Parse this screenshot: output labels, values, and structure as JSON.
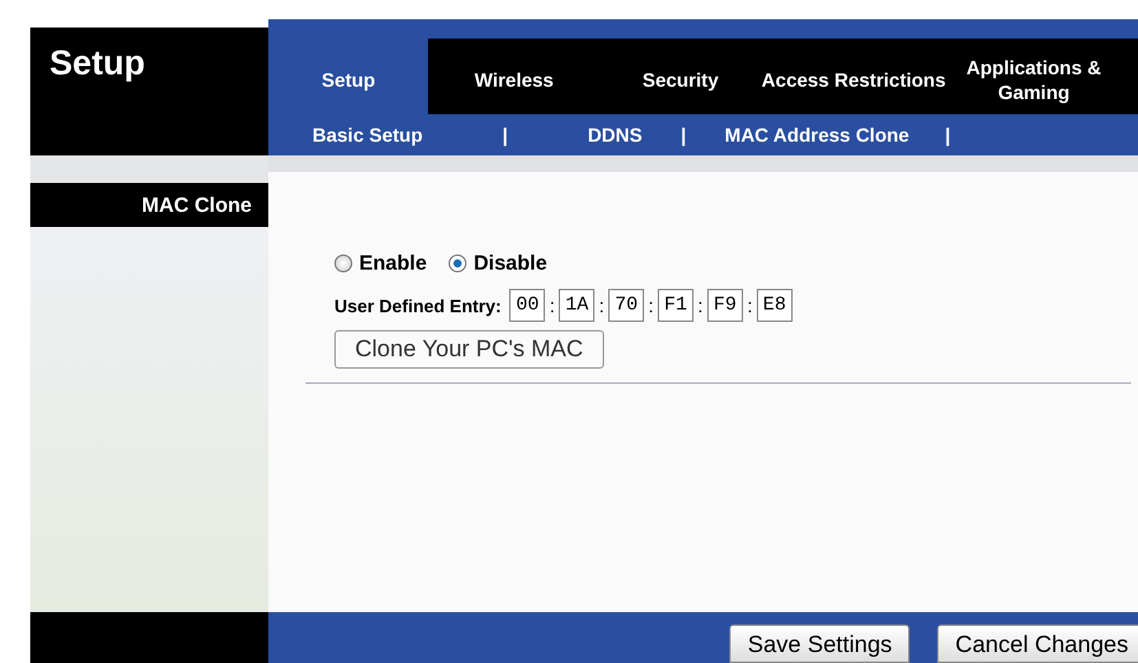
{
  "page_title": "Setup",
  "tabs": [
    {
      "label": "Setup",
      "selected": true
    },
    {
      "label": "Wireless",
      "selected": false
    },
    {
      "label": "Security",
      "selected": false
    },
    {
      "label": "Access Restrictions",
      "selected": false
    },
    {
      "label": "Applications & Gaming",
      "selected": false
    }
  ],
  "subtabs": [
    {
      "kind": "link",
      "label": "Basic Setup"
    },
    {
      "kind": "separator",
      "label": "|"
    },
    {
      "kind": "link",
      "label": "DDNS"
    },
    {
      "kind": "separator",
      "label": "|"
    },
    {
      "kind": "link",
      "label": "MAC Address Clone"
    },
    {
      "kind": "separator",
      "label": "|"
    }
  ],
  "section": "MAC Clone",
  "radios": [
    {
      "label": "Enable",
      "selected": false
    },
    {
      "label": "Disable",
      "selected": true
    }
  ],
  "entry": {
    "label": "User Defined Entry:",
    "octets": [
      "00",
      "1A",
      "70",
      "F1",
      "F9",
      "E8"
    ],
    "separator": ":"
  },
  "clone_button": "Clone Your PC's MAC",
  "buttons": [
    "Save Settings",
    "Cancel Changes"
  ]
}
